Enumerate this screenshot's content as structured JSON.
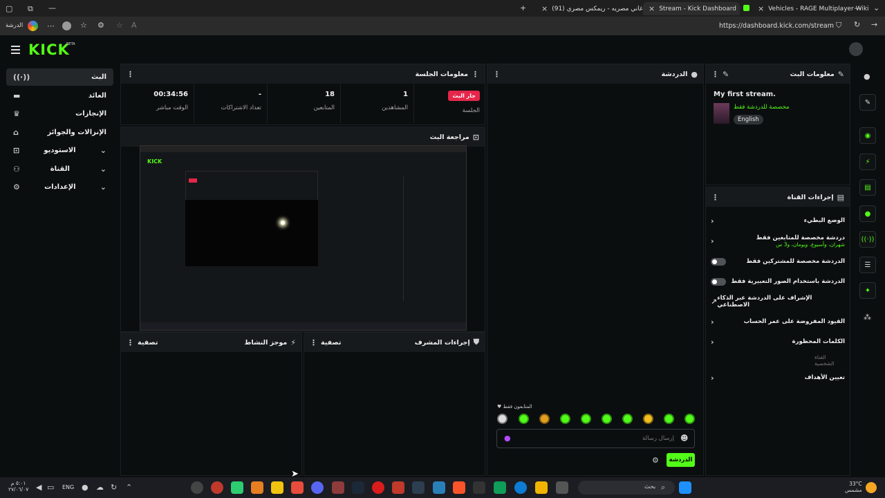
{
  "browser": {
    "tabs": [
      {
        "label": "(91) اغاني مصريه - ريمكس مصري",
        "active": false
      },
      {
        "label": "Stream - Kick Dashboard",
        "active": true
      },
      {
        "label": "Vehicles - RAGE Multiplayer Wiki",
        "active": false
      }
    ],
    "profile_label": "الدرشة",
    "url": "https://dashboard.kick.com/stream"
  },
  "header": {
    "logo": "KICK",
    "logo_tag": "BETA"
  },
  "sidebar": {
    "items": [
      {
        "label": "البث",
        "icon": "broadcast-icon",
        "active": true
      },
      {
        "label": "العائد",
        "icon": "money-icon"
      },
      {
        "label": "الإنجازات",
        "icon": "trophy-icon"
      },
      {
        "label": "الإنزالات والجوائز",
        "icon": "gift-icon"
      },
      {
        "label": "الاستوديو",
        "icon": "studio-icon",
        "expandable": true
      },
      {
        "label": "القناة",
        "icon": "channel-icon",
        "expandable": true
      },
      {
        "label": "الإعدادات",
        "icon": "gear-icon",
        "expandable": true
      }
    ]
  },
  "session": {
    "title": "معلومات الجلسة",
    "stats": [
      {
        "value": "جار البث",
        "label": "الجلسة",
        "is_badge": true
      },
      {
        "value": "1",
        "label": "المشاهدين"
      },
      {
        "value": "18",
        "label": "المتابعين"
      },
      {
        "value": "-",
        "label": "تعداد الاشتراكات"
      },
      {
        "value": "00:34:56",
        "label": "الوقت مباشر"
      }
    ]
  },
  "preview": {
    "title": "مراجعة البث",
    "mini_logo": "KICK"
  },
  "activity": {
    "title": "موجز النشاط",
    "filter": "تصفية"
  },
  "mod_actions": {
    "title": "إجراءات المشرف",
    "filter": "تصفية"
  },
  "chat": {
    "title": "الدردشة",
    "followers_only": "المتابعون فقط",
    "placeholder": "إرسال رسالة",
    "send_label": "الدردشة"
  },
  "stream_info": {
    "title": "معلومات البث",
    "stream_title": "My first stream.",
    "category": "مخصصة للدردشة فقط",
    "language": "English"
  },
  "channel_actions": {
    "title": "إجراءات القناة",
    "items": [
      {
        "label": "الوضع البطيء",
        "type": "chevron"
      },
      {
        "label": "دردشة مخصصة للمتابعين فقط",
        "sub": "شهران، وأسبوع، ويومان، و3 س",
        "type": "chevron"
      },
      {
        "label": "الدردشة مخصصة للمشتركين فقط",
        "type": "toggle",
        "on": false
      },
      {
        "label": "الدردشة باستخدام الصور التعبيرية فقط",
        "type": "toggle",
        "on": false
      },
      {
        "label": "الإشراف على الدردشة عبر الذكاء الاصطناعي",
        "type": "external"
      },
      {
        "label": "القيود المفروضة على عمر الحساب",
        "type": "chevron"
      },
      {
        "label": "الكلمات المحظورة",
        "type": "chevron"
      },
      {
        "label": "القناة الشخصية",
        "type": "section"
      },
      {
        "label": "تعيين الأهداف",
        "type": "chevron"
      }
    ]
  },
  "taskbar": {
    "time": "٥:٠١ م",
    "date": "٢٧/٠٦/٠٧",
    "lang": "ENG",
    "search_label": "بحث",
    "weather_temp": "33°C",
    "weather_desc": "مشمس"
  },
  "colors": {
    "accent": "#53fc18",
    "live": "#e5264a",
    "bg": "#0b0e0f",
    "panel_head": "#161a1c"
  }
}
